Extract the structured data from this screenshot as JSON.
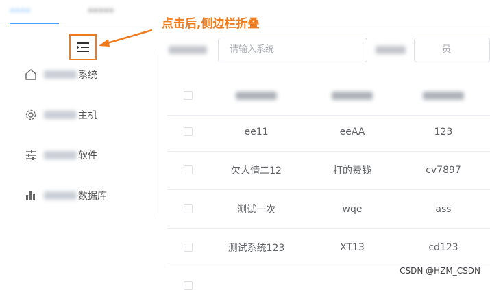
{
  "header": {
    "tabs": [
      "••••",
      "•••••"
    ]
  },
  "annotation": {
    "text": "点击后,侧边栏折叠",
    "color": "#f07b1d"
  },
  "sidebar": {
    "collapse_icon": "menu-fold-icon",
    "items": [
      {
        "icon": "home-icon",
        "label_visible": "系统"
      },
      {
        "icon": "gear-icon",
        "label_visible": "主机"
      },
      {
        "icon": "sliders-icon",
        "label_visible": "软件"
      },
      {
        "icon": "bar-chart-icon",
        "label_visible": "数据库"
      }
    ]
  },
  "search": {
    "input1_placeholder": "请输入系统",
    "input2_placeholder": "员"
  },
  "table": {
    "rows": [
      [
        "ee11",
        "eeAA",
        "123"
      ],
      [
        "欠人情二12",
        "打的费钱",
        "cv7897"
      ],
      [
        "测试一次",
        "wqe",
        "ass"
      ],
      [
        "测试系统123",
        "XT13",
        "cd123"
      ]
    ]
  },
  "watermark": "CSDN @HZM_CSDN"
}
